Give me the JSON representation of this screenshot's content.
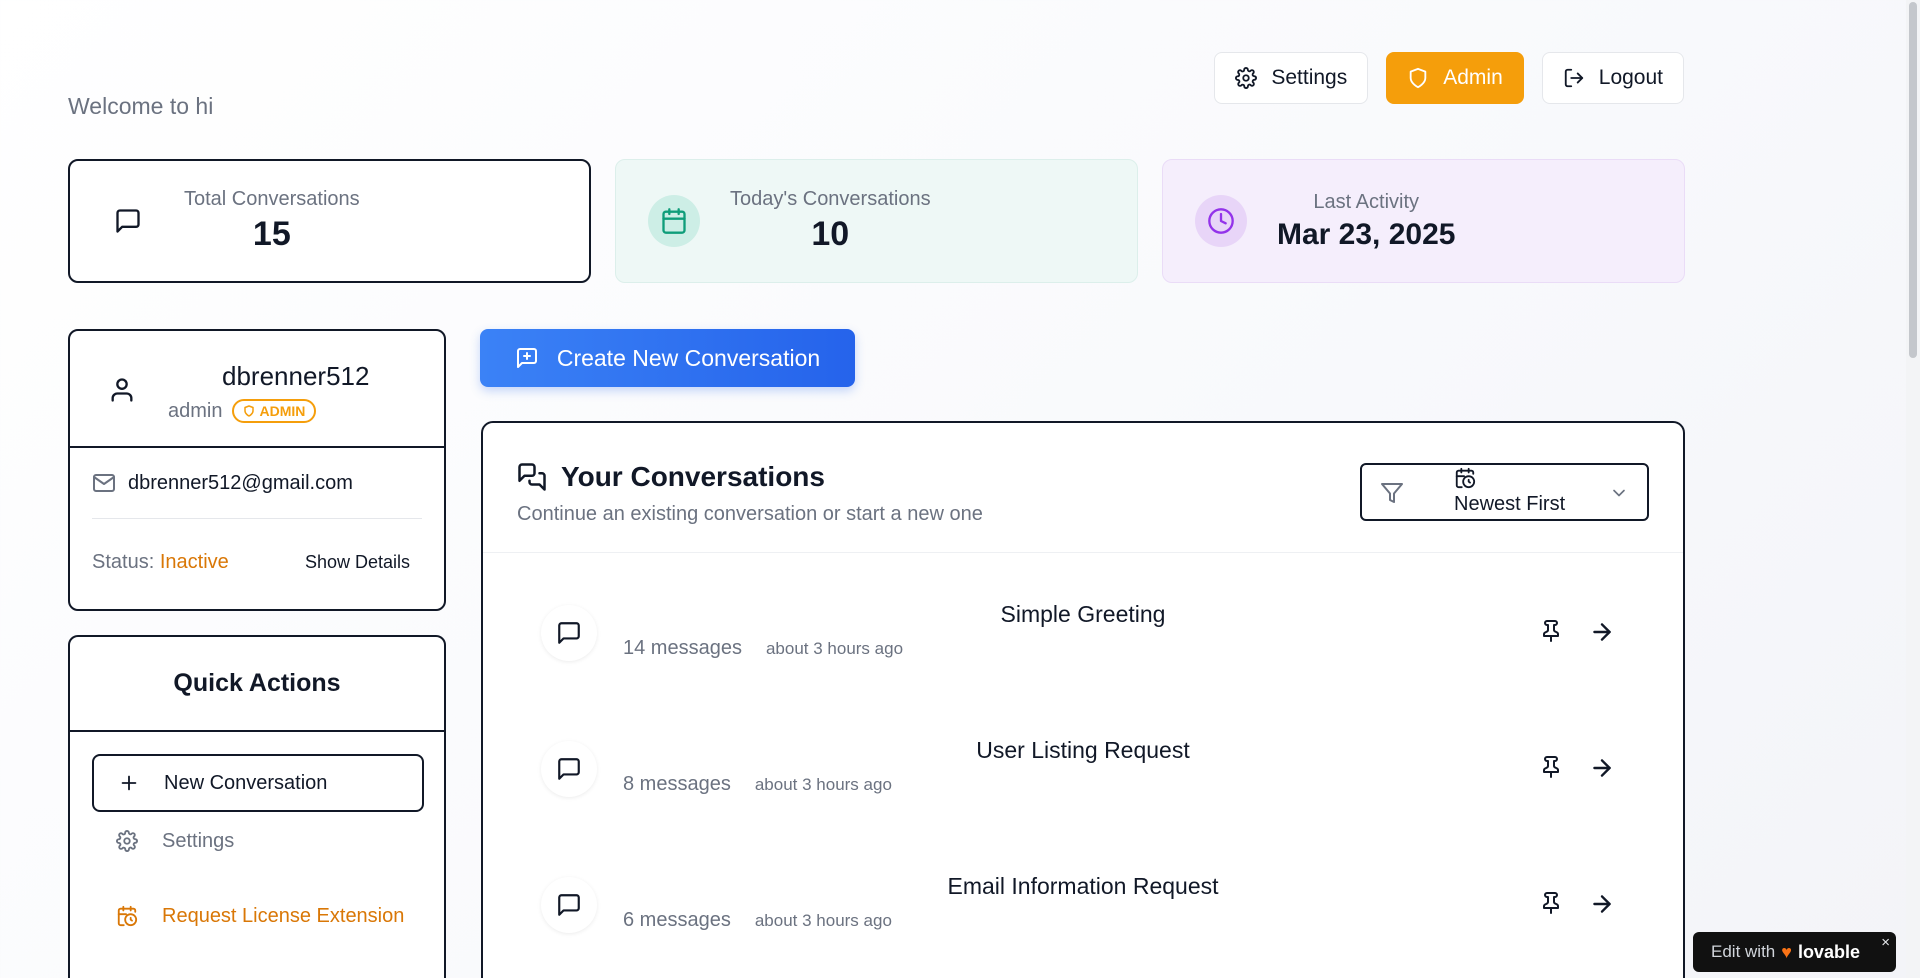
{
  "header": {
    "welcome": "Welcome to hi",
    "settings_label": "Settings",
    "admin_label": "Admin",
    "logout_label": "Logout"
  },
  "stats": [
    {
      "label": "Total Conversations",
      "value": "15",
      "icon": "message-square-icon"
    },
    {
      "label": "Today's Conversations",
      "value": "10",
      "icon": "calendar-icon"
    },
    {
      "label": "Last Activity",
      "value": "Mar 23, 2025",
      "icon": "clock-icon"
    }
  ],
  "profile": {
    "username": "dbrenner512",
    "role": "admin",
    "badge": "ADMIN",
    "email": "dbrenner512@gmail.com",
    "status_label": "Status:",
    "status_value": "Inactive",
    "show_details": "Show Details"
  },
  "quick_actions": {
    "title": "Quick Actions",
    "items": [
      {
        "label": "New Conversation",
        "icon": "plus-icon"
      },
      {
        "label": "Settings",
        "icon": "gear-icon"
      },
      {
        "label": "Request License Extension",
        "icon": "calendar-clock-icon"
      }
    ]
  },
  "create_button": "Create New Conversation",
  "conversations": {
    "title": "Your Conversations",
    "subtitle": "Continue an existing conversation or start a new one",
    "sort": "Newest First",
    "items": [
      {
        "title": "Simple Greeting",
        "count": "14 messages",
        "time": "about 3 hours ago"
      },
      {
        "title": "User Listing Request",
        "count": "8 messages",
        "time": "about 3 hours ago"
      },
      {
        "title": "Email Information Request",
        "count": "6 messages",
        "time": "about 3 hours ago"
      }
    ]
  },
  "lovable": {
    "edit": "Edit with",
    "brand": "lovable",
    "close": "×"
  },
  "colors": {
    "accent_blue": "#2563eb",
    "admin_amber": "#f59e0b",
    "status_orange": "#d97706",
    "teal_tint": "#eef8f6",
    "purple_tint": "#f5eefc"
  }
}
